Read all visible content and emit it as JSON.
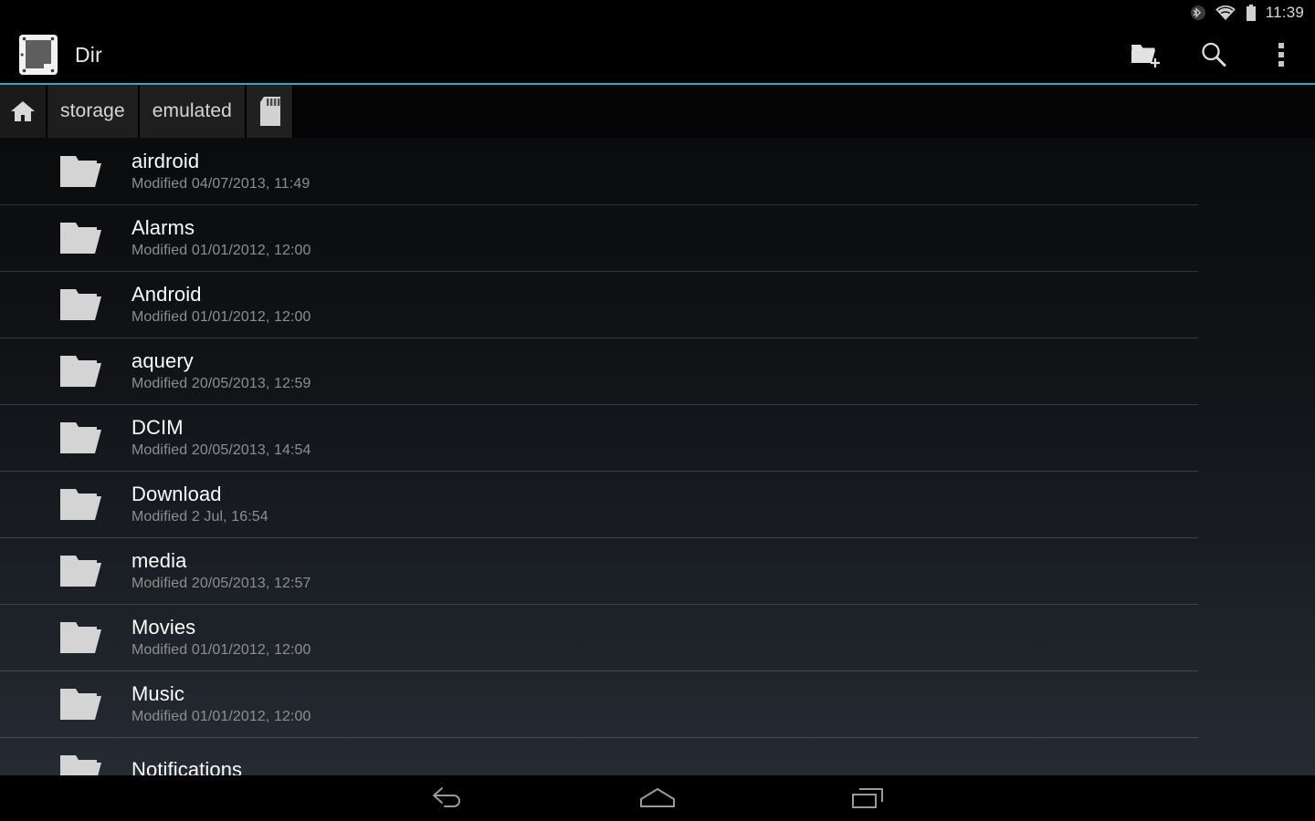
{
  "status_bar": {
    "icons": [
      "bluetooth-icon",
      "wifi-icon",
      "battery-icon"
    ],
    "time": "11:39"
  },
  "action_bar": {
    "app_icon": "dir-app-icon",
    "title": "Dir",
    "actions": [
      {
        "name": "new-folder-icon",
        "label": "New folder"
      },
      {
        "name": "search-icon",
        "label": "Search"
      },
      {
        "name": "overflow-menu-icon",
        "label": "More options"
      }
    ]
  },
  "breadcrumb": {
    "home_icon": "home-icon",
    "items": [
      {
        "label": "storage"
      },
      {
        "label": "emulated"
      }
    ],
    "sd_icon": "sd-card-icon"
  },
  "files": [
    {
      "name": "airdroid",
      "modified": "Modified 04/07/2013, 11:49",
      "icon": "folder-icon"
    },
    {
      "name": "Alarms",
      "modified": "Modified 01/01/2012, 12:00",
      "icon": "folder-icon"
    },
    {
      "name": "Android",
      "modified": "Modified 01/01/2012, 12:00",
      "icon": "folder-icon"
    },
    {
      "name": "aquery",
      "modified": "Modified 20/05/2013, 12:59",
      "icon": "folder-icon"
    },
    {
      "name": "DCIM",
      "modified": "Modified 20/05/2013, 14:54",
      "icon": "folder-icon"
    },
    {
      "name": "Download",
      "modified": "Modified 2 Jul, 16:54",
      "icon": "folder-icon"
    },
    {
      "name": "media",
      "modified": "Modified 20/05/2013, 12:57",
      "icon": "folder-icon"
    },
    {
      "name": "Movies",
      "modified": "Modified 01/01/2012, 12:00",
      "icon": "folder-icon"
    },
    {
      "name": "Music",
      "modified": "Modified 01/01/2012, 12:00",
      "icon": "folder-icon"
    },
    {
      "name": "Notifications",
      "modified": "",
      "icon": "folder-icon"
    }
  ],
  "nav_bar": {
    "back": "back-icon",
    "home": "home-icon",
    "recents": "recents-icon"
  },
  "colors": {
    "accent": "#2ca5d6",
    "action_bar_bg": "#000000",
    "list_bg_top": "#0a0b0c",
    "list_bg_bottom": "#262b33",
    "title_text": "#fbfbfb",
    "subtitle_text": "#8e8e8e",
    "folder_icon": "#d4d4d4"
  }
}
